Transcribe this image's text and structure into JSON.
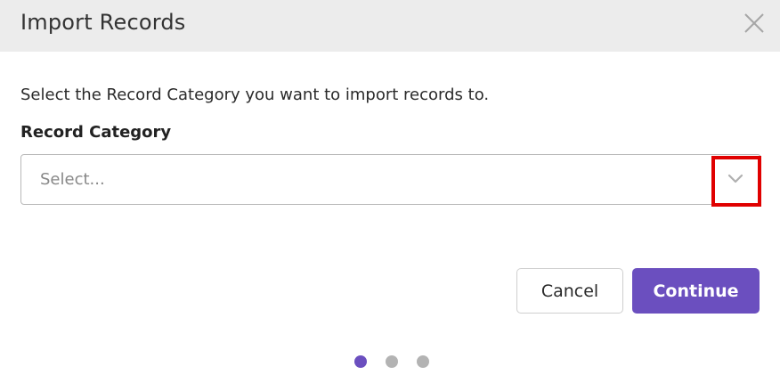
{
  "dialog": {
    "title": "Import Records",
    "close_icon": "close-icon"
  },
  "body": {
    "instruction": "Select the Record Category you want to import records to.",
    "field_label": "Record Category",
    "select": {
      "placeholder": "Select...",
      "toggle_icon": "chevron-down-icon"
    }
  },
  "actions": {
    "cancel_label": "Cancel",
    "continue_label": "Continue"
  },
  "stepper": {
    "total_steps": 3,
    "current_step": 1
  },
  "colors": {
    "header_bg": "#ececec",
    "accent": "#6b4fbf",
    "inactive_dot": "#b3b3b3",
    "highlight": "#e00000"
  }
}
